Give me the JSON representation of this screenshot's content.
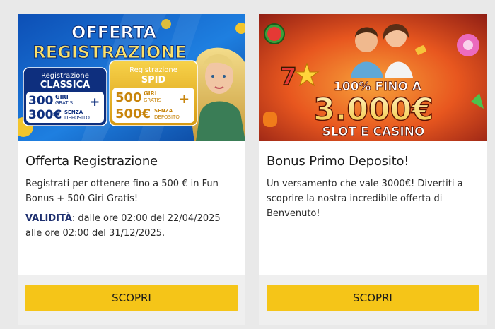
{
  "promos": [
    {
      "banner": {
        "headline": [
          "OFFERTA",
          "REGISTRAZIONE"
        ],
        "box_classic": {
          "title": [
            "Registrazione",
            "CLASSICA"
          ],
          "line1": {
            "amount": "300",
            "unit": "GIRI",
            "sub": "GRATIS",
            "plus": "+"
          },
          "line2": {
            "amount": "300€",
            "unit": "SENZA",
            "sub": "DEPOSITO"
          }
        },
        "box_spid": {
          "title": [
            "Registrazione",
            "SPID"
          ],
          "line1": {
            "amount": "500",
            "unit": "GIRI",
            "sub": "GRATIS",
            "plus": "+"
          },
          "line2": {
            "amount": "500€",
            "unit": "SENZA",
            "sub": "DEPOSITO"
          }
        }
      },
      "title": "Offerta Registrazione",
      "description": "Registrati per ottenere fino a 500 € in Fun Bonus + 500 Giri Gratis!",
      "validity_label": "VALIDITÀ",
      "validity_text": ": dalle ore 02:00 del 22/04/2025 alle ore 02:00 del 31/12/2025.",
      "cta": "SCOPRI"
    },
    {
      "banner": {
        "line1": "100% FINO A",
        "amount": "3.000€",
        "line3": "SLOT E CASINO"
      },
      "title": "Bonus Primo Deposito!",
      "description": "Un versamento che vale 3000€! Divertiti a scoprire la nostra incredibile offerta di Benvenuto!",
      "cta": "SCOPRI"
    }
  ],
  "colors": {
    "cta_bg": "#f5c518",
    "validity_label": "#1d2f6f",
    "page_bg": "#e9e9e9",
    "banner_a_blue": "#1565c0",
    "banner_b_orange": "#e8571f"
  }
}
